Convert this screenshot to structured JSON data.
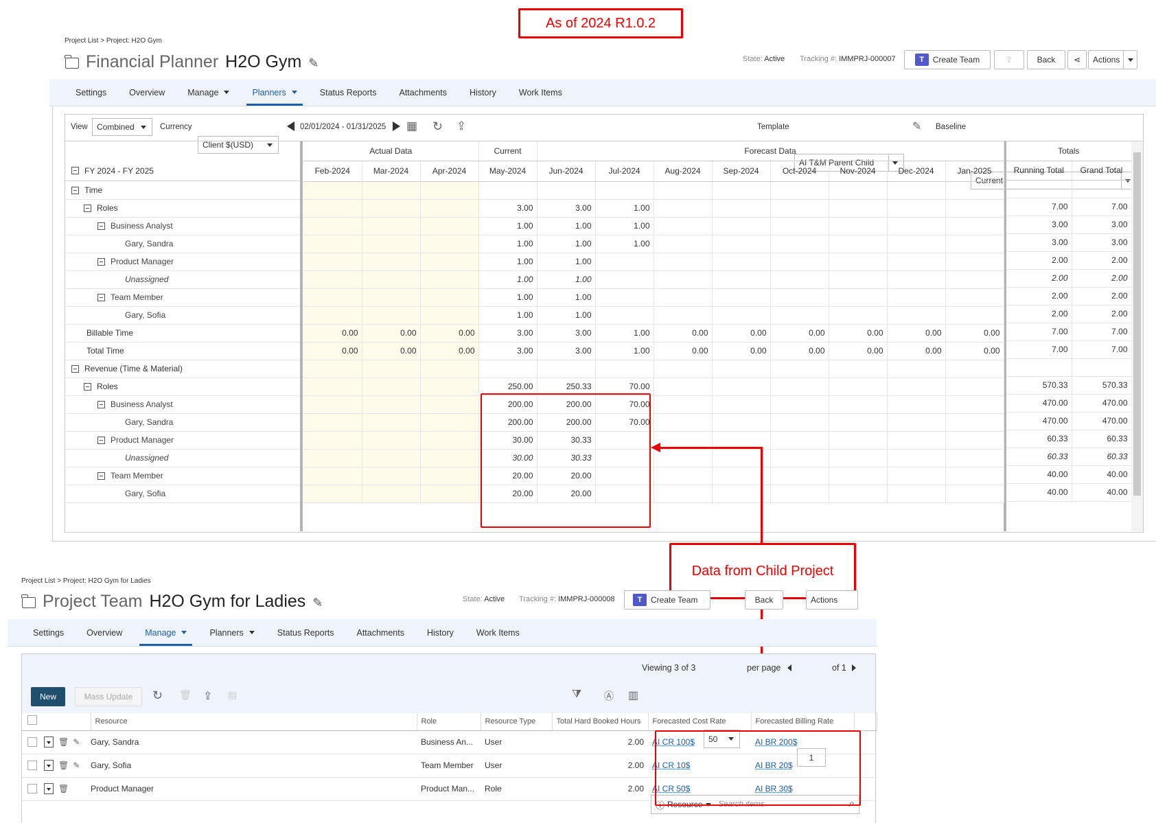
{
  "callouts": {
    "version": "As of 2024 R1.0.2",
    "child": "Data from Child Project"
  },
  "fp": {
    "breadcrumb": "Project List > Project: H2O Gym",
    "title_section": "Financial Planner",
    "title_project": "H2O Gym",
    "state_label": "State:",
    "state_value": "Active",
    "tracking_label": "Tracking #:",
    "tracking_value": "IMMPRJ-000007",
    "create_team": "Create Team",
    "back": "Back",
    "actions": "Actions",
    "tabs": [
      "Settings",
      "Overview",
      "Manage",
      "Planners",
      "Status Reports",
      "Attachments",
      "History",
      "Work Items"
    ],
    "toolbar": {
      "view_label": "View",
      "view_value": "Combined",
      "currency_label": "Currency",
      "currency_value": "Client $(USD)",
      "date_range": "02/01/2024 - 01/31/2025",
      "template_label": "Template",
      "template_value": "AI T&M Parent Child",
      "baseline_label": "Baseline",
      "baseline_value": "Current"
    },
    "grid": {
      "groups": {
        "actual": "Actual Data",
        "current": "Current",
        "forecast": "Forecast Data",
        "totals": "Totals"
      },
      "period": "FY 2024 - FY 2025",
      "months": [
        "Feb-2024",
        "Mar-2024",
        "Apr-2024",
        "May-2024",
        "Jun-2024",
        "Jul-2024",
        "Aug-2024",
        "Sep-2024",
        "Oct-2024",
        "Nov-2024",
        "Dec-2024",
        "Jan-2025"
      ],
      "totals_cols": [
        "Running Total",
        "Grand Total"
      ],
      "rows": [
        {
          "label": "Time",
          "indent": 0,
          "toggle": true,
          "vals": [
            "",
            "",
            "",
            "",
            "",
            "",
            "",
            "",
            "",
            "",
            "",
            ""
          ],
          "tot": [
            "",
            ""
          ]
        },
        {
          "label": "Roles",
          "indent": 1,
          "toggle": true,
          "vals": [
            "",
            "",
            "",
            "3.00",
            "3.00",
            "1.00",
            "",
            "",
            "",
            "",
            "",
            ""
          ],
          "tot": [
            "7.00",
            "7.00"
          ]
        },
        {
          "label": "Business Analyst",
          "indent": 2,
          "toggle": true,
          "vals": [
            "",
            "",
            "",
            "1.00",
            "1.00",
            "1.00",
            "",
            "",
            "",
            "",
            "",
            ""
          ],
          "tot": [
            "3.00",
            "3.00"
          ]
        },
        {
          "label": "Gary, Sandra",
          "indent": 3,
          "toggle": false,
          "vals": [
            "",
            "",
            "",
            "1.00",
            "1.00",
            "1.00",
            "",
            "",
            "",
            "",
            "",
            ""
          ],
          "tot": [
            "3.00",
            "3.00"
          ]
        },
        {
          "label": "Product Manager",
          "indent": 2,
          "toggle": true,
          "vals": [
            "",
            "",
            "",
            "1.00",
            "1.00",
            "",
            "",
            "",
            "",
            "",
            "",
            ""
          ],
          "tot": [
            "2.00",
            "2.00"
          ]
        },
        {
          "label": "Unassigned",
          "indent": 3,
          "toggle": false,
          "italic": true,
          "vals": [
            "",
            "",
            "",
            "1.00",
            "1.00",
            "",
            "",
            "",
            "",
            "",
            "",
            ""
          ],
          "tot": [
            "2.00",
            "2.00"
          ]
        },
        {
          "label": "Team Member",
          "indent": 2,
          "toggle": true,
          "vals": [
            "",
            "",
            "",
            "1.00",
            "1.00",
            "",
            "",
            "",
            "",
            "",
            "",
            ""
          ],
          "tot": [
            "2.00",
            "2.00"
          ]
        },
        {
          "label": "Gary, Sofia",
          "indent": 3,
          "toggle": false,
          "vals": [
            "",
            "",
            "",
            "1.00",
            "1.00",
            "",
            "",
            "",
            "",
            "",
            "",
            ""
          ],
          "tot": [
            "2.00",
            "2.00"
          ]
        },
        {
          "label": "Billable Time",
          "indent": 1,
          "toggle": false,
          "vals": [
            "0.00",
            "0.00",
            "0.00",
            "3.00",
            "3.00",
            "1.00",
            "0.00",
            "0.00",
            "0.00",
            "0.00",
            "0.00",
            "0.00"
          ],
          "tot": [
            "7.00",
            "7.00"
          ]
        },
        {
          "label": "Total Time",
          "indent": 1,
          "toggle": false,
          "vals": [
            "0.00",
            "0.00",
            "0.00",
            "3.00",
            "3.00",
            "1.00",
            "0.00",
            "0.00",
            "0.00",
            "0.00",
            "0.00",
            "0.00"
          ],
          "tot": [
            "7.00",
            "7.00"
          ]
        },
        {
          "label": "Revenue (Time & Material)",
          "indent": 0,
          "toggle": true,
          "vals": [
            "",
            "",
            "",
            "",
            "",
            "",
            "",
            "",
            "",
            "",
            "",
            ""
          ],
          "tot": [
            "",
            ""
          ]
        },
        {
          "label": "Roles",
          "indent": 1,
          "toggle": true,
          "vals": [
            "",
            "",
            "",
            "250.00",
            "250.33",
            "70.00",
            "",
            "",
            "",
            "",
            "",
            ""
          ],
          "tot": [
            "570.33",
            "570.33"
          ]
        },
        {
          "label": "Business Analyst",
          "indent": 2,
          "toggle": true,
          "vals": [
            "",
            "",
            "",
            "200.00",
            "200.00",
            "70.00",
            "",
            "",
            "",
            "",
            "",
            ""
          ],
          "tot": [
            "470.00",
            "470.00"
          ]
        },
        {
          "label": "Gary, Sandra",
          "indent": 3,
          "toggle": false,
          "vals": [
            "",
            "",
            "",
            "200.00",
            "200.00",
            "70.00",
            "",
            "",
            "",
            "",
            "",
            ""
          ],
          "tot": [
            "470.00",
            "470.00"
          ]
        },
        {
          "label": "Product Manager",
          "indent": 2,
          "toggle": true,
          "vals": [
            "",
            "",
            "",
            "30.00",
            "30.33",
            "",
            "",
            "",
            "",
            "",
            "",
            ""
          ],
          "tot": [
            "60.33",
            "60.33"
          ]
        },
        {
          "label": "Unassigned",
          "indent": 3,
          "toggle": false,
          "italic": true,
          "vals": [
            "",
            "",
            "",
            "30.00",
            "30.33",
            "",
            "",
            "",
            "",
            "",
            "",
            ""
          ],
          "tot": [
            "60.33",
            "60.33"
          ]
        },
        {
          "label": "Team Member",
          "indent": 2,
          "toggle": true,
          "vals": [
            "",
            "",
            "",
            "20.00",
            "20.00",
            "",
            "",
            "",
            "",
            "",
            "",
            ""
          ],
          "tot": [
            "40.00",
            "40.00"
          ]
        },
        {
          "label": "Gary, Sofia",
          "indent": 3,
          "toggle": false,
          "vals": [
            "",
            "",
            "",
            "20.00",
            "20.00",
            "",
            "",
            "",
            "",
            "",
            "",
            ""
          ],
          "tot": [
            "40.00",
            "40.00"
          ]
        }
      ]
    }
  },
  "pt": {
    "breadcrumb": "Project List > Project: H2O Gym for Ladies",
    "title_section": "Project Team",
    "title_project": "H2O Gym for Ladies",
    "state_label": "State:",
    "state_value": "Active",
    "tracking_label": "Tracking #:",
    "tracking_value": "IMMPRJ-000008",
    "create_team": "Create Team",
    "back": "Back",
    "actions": "Actions",
    "tabs": [
      "Settings",
      "Overview",
      "Manage",
      "Planners",
      "Status Reports",
      "Attachments",
      "History",
      "Work Items"
    ],
    "paging": {
      "viewing": "Viewing",
      "count": "3 of 3",
      "per_page_value": "50",
      "per_page": "per page",
      "page": "1",
      "of": "of 1"
    },
    "new": "New",
    "mass_update": "Mass Update",
    "search_scope": "Resource",
    "search_placeholder": "Search items",
    "columns": [
      "Resource",
      "Role",
      "Resource Type",
      "Total Hard Booked Hours",
      "Forecasted Cost Rate",
      "Forecasted Billing Rate"
    ],
    "rows": [
      {
        "resource": "Gary, Sandra",
        "role": "Business An...",
        "type": "User",
        "hours": "2.00",
        "cost": "AI CR 100$",
        "bill": "AI BR 200$",
        "edit": true
      },
      {
        "resource": "Gary, Sofia",
        "role": "Team Member",
        "type": "User",
        "hours": "2.00",
        "cost": "AI CR 10$",
        "bill": "AI BR 20$",
        "edit": true
      },
      {
        "resource": "Product Manager",
        "role": "Product Man...",
        "type": "Role",
        "hours": "2.00",
        "cost": "AI CR 50$",
        "bill": "AI BR 30$",
        "edit": false
      }
    ]
  }
}
